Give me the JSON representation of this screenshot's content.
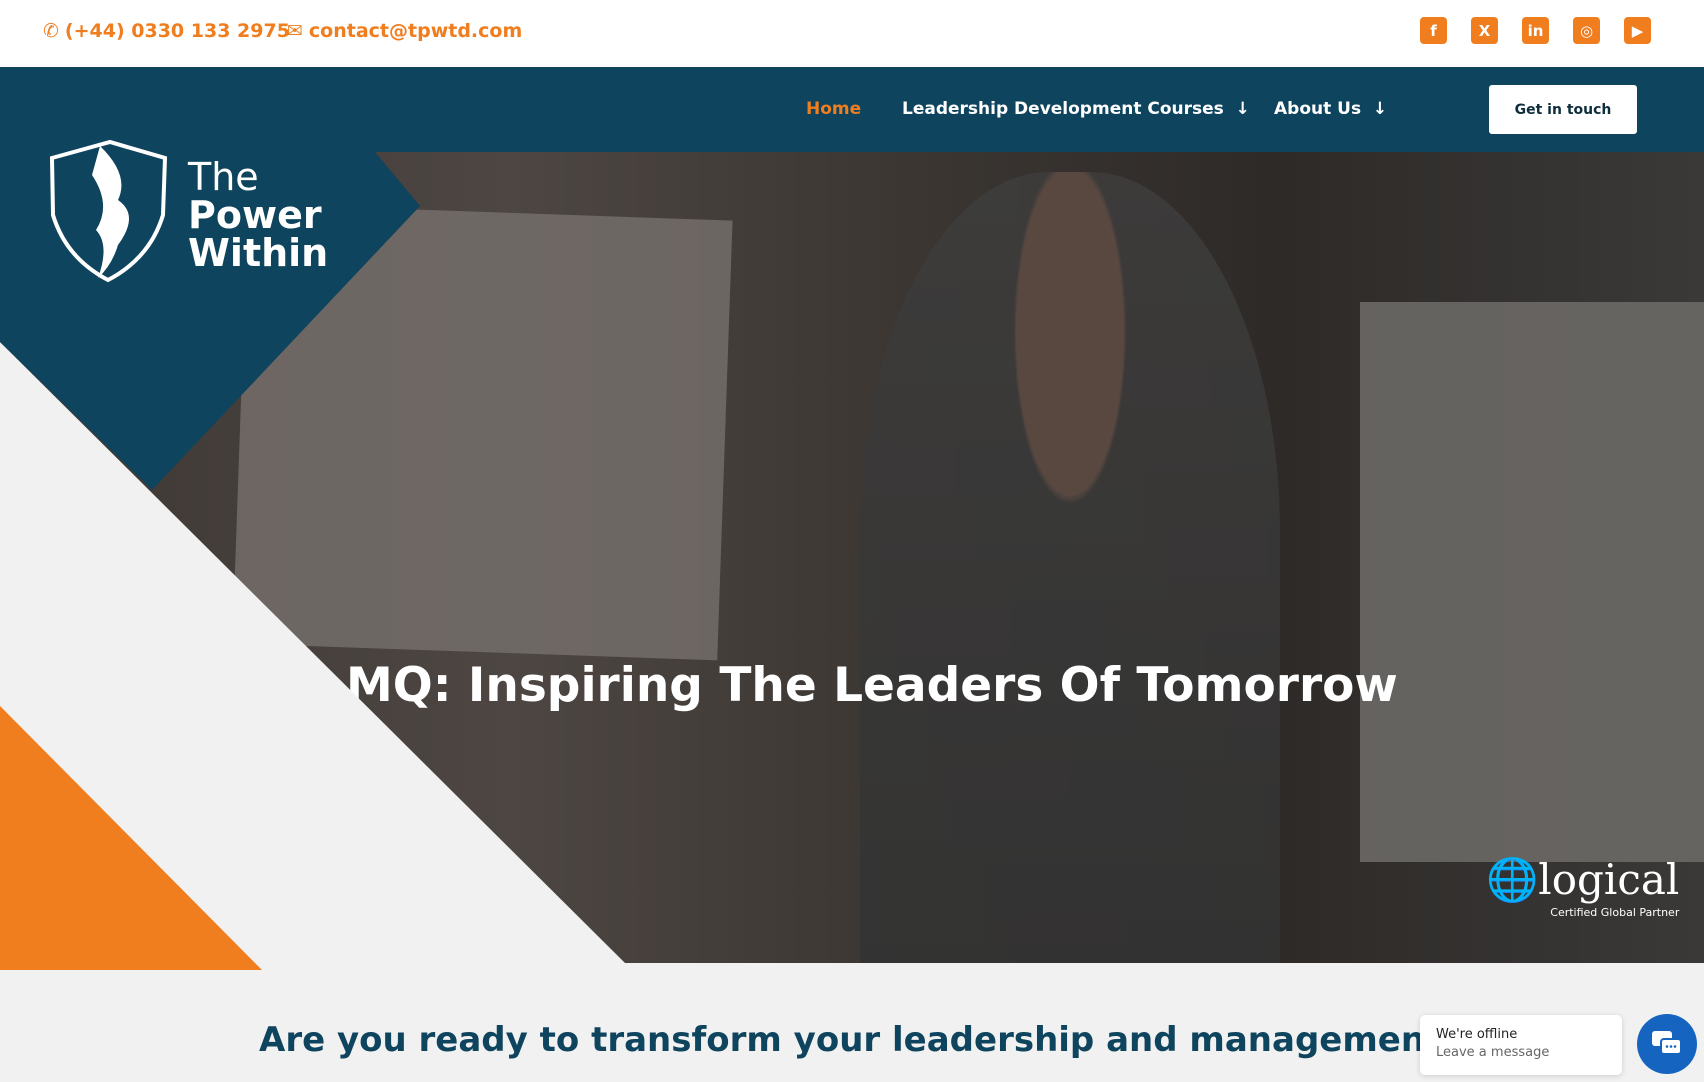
{
  "topbar": {
    "phone": "(+44) 0330 133 2975",
    "email": "contact@tpwtd.com",
    "social": [
      "facebook-icon",
      "x-icon",
      "linkedin-icon",
      "instagram-icon",
      "youtube-icon"
    ]
  },
  "nav": {
    "items": [
      {
        "label": "Home",
        "active": true
      },
      {
        "label": "Leadership Development Courses"
      },
      {
        "label": "About Us"
      }
    ],
    "cta": "Get in touch"
  },
  "logo": {
    "line1": "The",
    "line2": "Power",
    "line3": "Within"
  },
  "hero": {
    "title": "MQ: Inspiring The Leaders Of Tomorrow",
    "partner": {
      "name": "logical",
      "tagline": "Certified Global Partner"
    }
  },
  "section": {
    "heading": "Are you ready to transform your leadership and management skills?"
  },
  "chat": {
    "status": "We're offline",
    "prompt": "Leave a message"
  },
  "colors": {
    "brand": "#0e445d",
    "accent": "#f07d1e",
    "chat": "#1565c0"
  }
}
